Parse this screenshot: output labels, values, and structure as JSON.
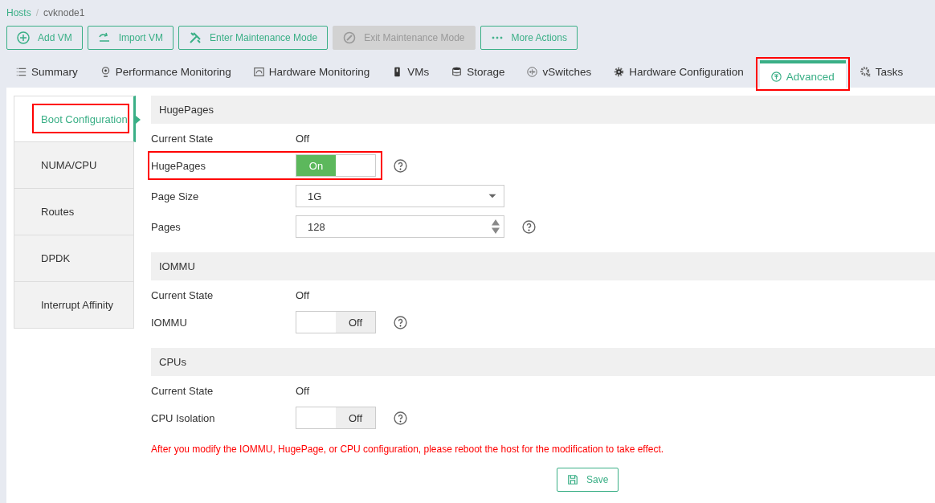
{
  "breadcrumb": [
    {
      "label": "Hosts",
      "link": true
    },
    {
      "label": "cvknode1",
      "link": false
    }
  ],
  "breadcrumb_separator": "/",
  "toolbar": [
    {
      "label": "Add VM",
      "disabled": false
    },
    {
      "label": "Import VM",
      "disabled": false
    },
    {
      "label": "Enter Maintenance Mode",
      "disabled": false
    },
    {
      "label": "Exit Maintenance Mode",
      "disabled": true
    },
    {
      "label": "More Actions",
      "disabled": false
    }
  ],
  "tabs": [
    {
      "label": "Summary",
      "selected": false,
      "highlighted": false
    },
    {
      "label": "Performance Monitoring",
      "selected": false,
      "highlighted": false
    },
    {
      "label": "Hardware Monitoring",
      "selected": false,
      "highlighted": false
    },
    {
      "label": "VMs",
      "selected": false,
      "highlighted": false
    },
    {
      "label": "Storage",
      "selected": false,
      "highlighted": false
    },
    {
      "label": "vSwitches",
      "selected": false,
      "highlighted": false
    },
    {
      "label": "Hardware Configuration",
      "selected": false,
      "highlighted": false
    },
    {
      "label": "Advanced",
      "selected": true,
      "highlighted": true
    },
    {
      "label": "Tasks",
      "selected": false,
      "highlighted": false
    }
  ],
  "sidebar": {
    "items": [
      {
        "label": "Boot Configuration",
        "selected": true,
        "highlighted": true
      },
      {
        "label": "NUMA/CPU",
        "selected": false,
        "highlighted": false
      },
      {
        "label": "Routes",
        "selected": false,
        "highlighted": false
      },
      {
        "label": "DPDK",
        "selected": false,
        "highlighted": false
      },
      {
        "label": "Interrupt Affinity",
        "selected": false,
        "highlighted": false
      }
    ]
  },
  "sections": [
    {
      "title": "HugePages",
      "rows": [
        {
          "kind": "text",
          "label": "Current State",
          "value": "Off",
          "help": false,
          "highlighted": false
        },
        {
          "kind": "switch",
          "label": "HugePages",
          "on": true,
          "on_text": "On",
          "help": true,
          "highlighted": true
        },
        {
          "kind": "select",
          "label": "Page Size",
          "value": "1G",
          "help": false,
          "highlighted": false
        },
        {
          "kind": "number",
          "label": "Pages",
          "value": "128",
          "help": true,
          "highlighted": false
        }
      ]
    },
    {
      "title": "IOMMU",
      "rows": [
        {
          "kind": "text",
          "label": "Current State",
          "value": "Off",
          "help": false,
          "highlighted": false
        },
        {
          "kind": "switch",
          "label": "IOMMU",
          "on": false,
          "off_text": "Off",
          "help": true,
          "highlighted": false
        }
      ]
    },
    {
      "title": "CPUs",
      "rows": [
        {
          "kind": "text",
          "label": "Current State",
          "value": "Off",
          "help": false,
          "highlighted": false
        },
        {
          "kind": "switch",
          "label": "CPU Isolation",
          "on": false,
          "off_text": "Off",
          "help": true,
          "highlighted": false
        }
      ]
    }
  ],
  "notice": "After you modify the IOMMU, HugePage, or CPU configuration, please reboot the host for the modification to take effect.",
  "save_button": "Save"
}
